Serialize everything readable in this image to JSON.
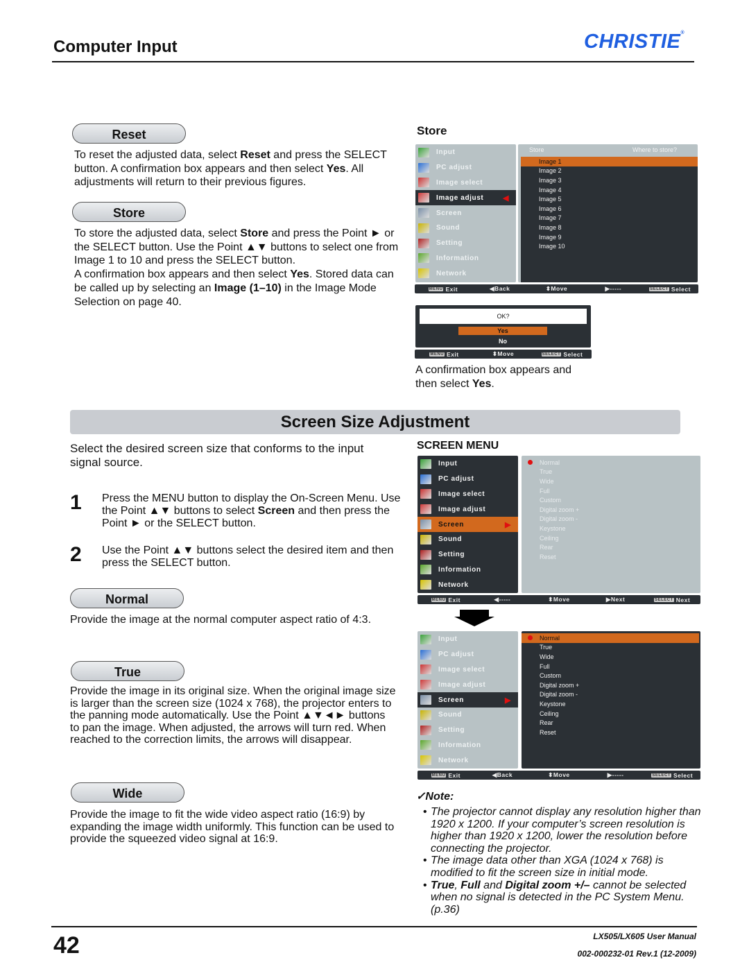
{
  "header": {
    "title": "Computer Input",
    "logo": "CHRISTIE",
    "logo_mark": "®",
    "brand_color": "#1f5fe0"
  },
  "reset": {
    "label": "Reset",
    "text": [
      {
        "t": "To reset the adjusted data, select "
      },
      {
        "t": "Reset",
        "b": true
      },
      {
        "t": " and press the SELECT button. A confirmation box appears and then select "
      },
      {
        "t": "Yes",
        "b": true
      },
      {
        "t": ". All adjustments will return to their previous figures."
      }
    ]
  },
  "store": {
    "label": "Store",
    "text": [
      {
        "t": "To store the adjusted data, select "
      },
      {
        "t": "Store",
        "b": true
      },
      {
        "t": " and press the Point ► or the SELECT button. Use the Point ▲▼ buttons to select one from Image 1 to 10 and press the SELECT button."
      },
      {
        "br": true
      },
      {
        "t": "A confirmation box appears and then select "
      },
      {
        "t": "Yes",
        "b": true
      },
      {
        "t": ". Stored data can be called up by selecting an "
      },
      {
        "t": "Image (1–10)",
        "b": true
      },
      {
        "t": " in the Image Mode Selection on page 40."
      }
    ]
  },
  "store_figure": {
    "heading": "Store",
    "caption": [
      {
        "t": "A confirmation box appears and then select "
      },
      {
        "t": "Yes",
        "b": true
      },
      {
        "t": "."
      }
    ]
  },
  "menu_items": [
    {
      "label": "Input",
      "icon": "input-icon",
      "color": "#3aa33a"
    },
    {
      "label": "PC adjust",
      "icon": "pc-adjust-icon",
      "color": "#2a6fd6"
    },
    {
      "label": "Image select",
      "icon": "image-select-icon",
      "color": "#c33"
    },
    {
      "label": "Image adjust",
      "icon": "image-adjust-icon",
      "color": "#d03a3a"
    },
    {
      "label": "Screen",
      "icon": "screen-icon",
      "color": "#7a8fa8"
    },
    {
      "label": "Sound",
      "icon": "sound-icon",
      "color": "#c9b400"
    },
    {
      "label": "Setting",
      "icon": "setting-icon",
      "color": "#b02020"
    },
    {
      "label": "Information",
      "icon": "information-icon",
      "color": "#5aa82a"
    },
    {
      "label": "Network",
      "icon": "network-icon",
      "color": "#d8c400"
    }
  ],
  "store_menu": {
    "active": 3,
    "title": "Store",
    "hint": "Where to store?",
    "items": [
      "Image 1",
      "Image 2",
      "Image 3",
      "Image 4",
      "Image 5",
      "Image 6",
      "Image 7",
      "Image 8",
      "Image 9",
      "Image 10"
    ],
    "selected": 0,
    "footer": [
      {
        "key": "MENU",
        "label": "Exit"
      },
      {
        "label": "◀Back"
      },
      {
        "label": "⬍Move"
      },
      {
        "label": "▶-----"
      },
      {
        "key": "SELECT",
        "label": "Select"
      }
    ]
  },
  "confirm": {
    "question": "OK?",
    "yes": "Yes",
    "no": "No",
    "footer": [
      {
        "key": "MENU",
        "label": "Exit"
      },
      {
        "label": "⬍Move"
      },
      {
        "key": "SELECT",
        "label": "Select"
      }
    ]
  },
  "screen_section": {
    "title": "Screen Size Adjustment",
    "intro": "Select the desired screen size that conforms to the input signal source.",
    "steps": [
      {
        "num": "1",
        "text": [
          {
            "t": "Press the MENU button to display the On-Screen Menu. Use the Point ▲▼ buttons to select "
          },
          {
            "t": "Screen",
            "b": true
          },
          {
            "t": " and then press the Point ► or the SELECT button."
          }
        ]
      },
      {
        "num": "2",
        "text": [
          {
            "t": "Use the Point ▲▼ buttons select the desired item and then press the SELECT button."
          }
        ]
      }
    ]
  },
  "normal": {
    "label": "Normal",
    "text": [
      {
        "t": "Provide the image at the normal computer aspect ratio of 4:3."
      }
    ]
  },
  "true": {
    "label": "True",
    "text": [
      {
        "t": "Provide the image in its original size. When the original image size is larger than the screen size (1024 x 768), the projector enters to the panning mode automatically. Use the Point ▲▼◄► buttons to pan the image. When adjusted, the arrows will turn red. When reached to the correction limits, the arrows will disappear."
      }
    ]
  },
  "wide": {
    "label": "Wide",
    "text": [
      {
        "t": "Provide the image to fit the wide video aspect ratio (16:9) by expanding the image width uniformly. This function can be used to provide the squeezed video signal at 16:9."
      }
    ]
  },
  "screen_menu": {
    "heading": "SCREEN MENU",
    "active": 4,
    "items": [
      "Normal",
      "True",
      "Wide",
      "Full",
      "Custom",
      "Digital zoom +",
      "Digital zoom -",
      "Keystone",
      "Ceiling",
      "Rear",
      "Reset"
    ],
    "selected": 0,
    "footer1": [
      {
        "key": "MENU",
        "label": "Exit"
      },
      {
        "label": "◀-----"
      },
      {
        "label": "⬍Move"
      },
      {
        "label": "▶Next"
      },
      {
        "key": "SELECT",
        "label": "Next"
      }
    ],
    "footer2": [
      {
        "key": "MENU",
        "label": "Exit"
      },
      {
        "label": "◀Back"
      },
      {
        "label": "⬍Move"
      },
      {
        "label": "▶-----"
      },
      {
        "key": "SELECT",
        "label": "Select"
      }
    ]
  },
  "note": {
    "title": "✓Note:",
    "items": [
      [
        {
          "t": "The projector cannot display any resolution higher than 1920 x 1200. If your computer’s screen resolution is higher than 1920 x 1200, lower the resolution before connecting the projector."
        }
      ],
      [
        {
          "t": "The image data other than XGA (1024 x 768) is modified to fit the screen size in initial mode."
        }
      ],
      [
        {
          "t": "True",
          "b": true
        },
        {
          "t": ", "
        },
        {
          "t": "Full",
          "b": true
        },
        {
          "t": " and "
        },
        {
          "t": "Digital zoom +/–",
          "b": true
        },
        {
          "t": " cannot be selected when no signal is detected in the PC System Menu. (p.36)"
        }
      ]
    ]
  },
  "footer": {
    "page": "42",
    "manual": "LX505/LX605 User Manual",
    "doc": "002-000232-01 Rev.1 (12-2009)"
  },
  "colors": {
    "menu_dark": "#2b3035",
    "menu_light": "#b8c2c5",
    "highlight": "#d2691e"
  }
}
